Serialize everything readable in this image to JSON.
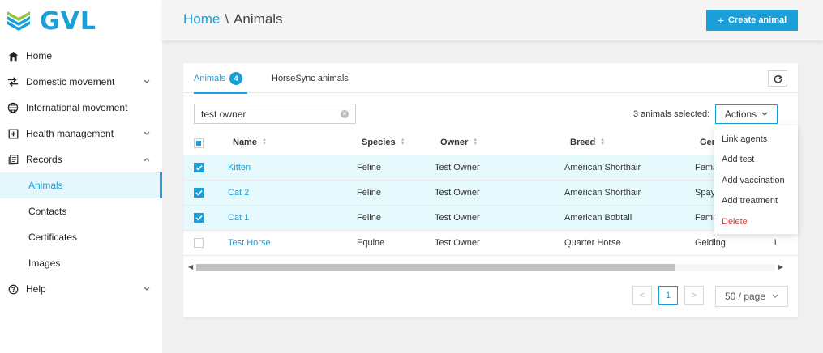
{
  "brand": {
    "name": "GVL"
  },
  "sidebar": {
    "items": [
      {
        "id": "home",
        "label": "Home",
        "icon": "home-icon",
        "chevron": ""
      },
      {
        "id": "domestic",
        "label": "Domestic movement",
        "icon": "swap-arrows-icon",
        "chevron": "down"
      },
      {
        "id": "international",
        "label": "International movement",
        "icon": "globe-icon",
        "chevron": ""
      },
      {
        "id": "health",
        "label": "Health management",
        "icon": "plus-square-icon",
        "chevron": "down"
      },
      {
        "id": "records",
        "label": "Records",
        "icon": "document-icon",
        "chevron": "up"
      }
    ],
    "records_sub": [
      "Animals",
      "Contacts",
      "Certificates",
      "Images"
    ],
    "help": {
      "label": "Help",
      "icon": "question-icon",
      "chevron": "down"
    }
  },
  "header": {
    "breadcrumb_home": "Home",
    "breadcrumb_sep": "\\",
    "breadcrumb_current": "Animals",
    "create_button": "Create animal"
  },
  "tabs": [
    {
      "label": "Animals",
      "badge": "4"
    },
    {
      "label": "HorseSync animals"
    }
  ],
  "toolbar": {
    "search_value": "test owner",
    "selected_text": "3 animals selected:",
    "actions_label": "Actions"
  },
  "table": {
    "columns": [
      "Name",
      "Species",
      "Owner",
      "Breed",
      "Ger"
    ],
    "rows": [
      {
        "name": "Kitten",
        "species": "Feline",
        "owner": "Test Owner",
        "breed": "American Shorthair",
        "gender": "Fema",
        "extra": "",
        "checked": true
      },
      {
        "name": "Cat 2",
        "species": "Feline",
        "owner": "Test Owner",
        "breed": "American Shorthair",
        "gender": "Spay",
        "extra": "",
        "checked": true
      },
      {
        "name": "Cat 1",
        "species": "Feline",
        "owner": "Test Owner",
        "breed": "American Bobtail",
        "gender": "Fema",
        "extra": "",
        "checked": true
      },
      {
        "name": "Test Horse",
        "species": "Equine",
        "owner": "Test Owner",
        "breed": "Quarter Horse",
        "gender": "Gelding",
        "extra": "1",
        "checked": false
      }
    ]
  },
  "pagination": {
    "prev": "<",
    "current": "1",
    "next": ">",
    "page_size": "50 / page"
  },
  "actions_menu": [
    {
      "label": "Link agents",
      "danger": false
    },
    {
      "label": "Add test",
      "danger": false
    },
    {
      "label": "Add vaccination",
      "danger": false
    },
    {
      "label": "Add treatment",
      "danger": false
    },
    {
      "label": "Delete",
      "danger": true
    }
  ],
  "colors": {
    "accent": "#1a9fd9",
    "danger": "#e53935",
    "selected_row": "#e6fafd"
  }
}
